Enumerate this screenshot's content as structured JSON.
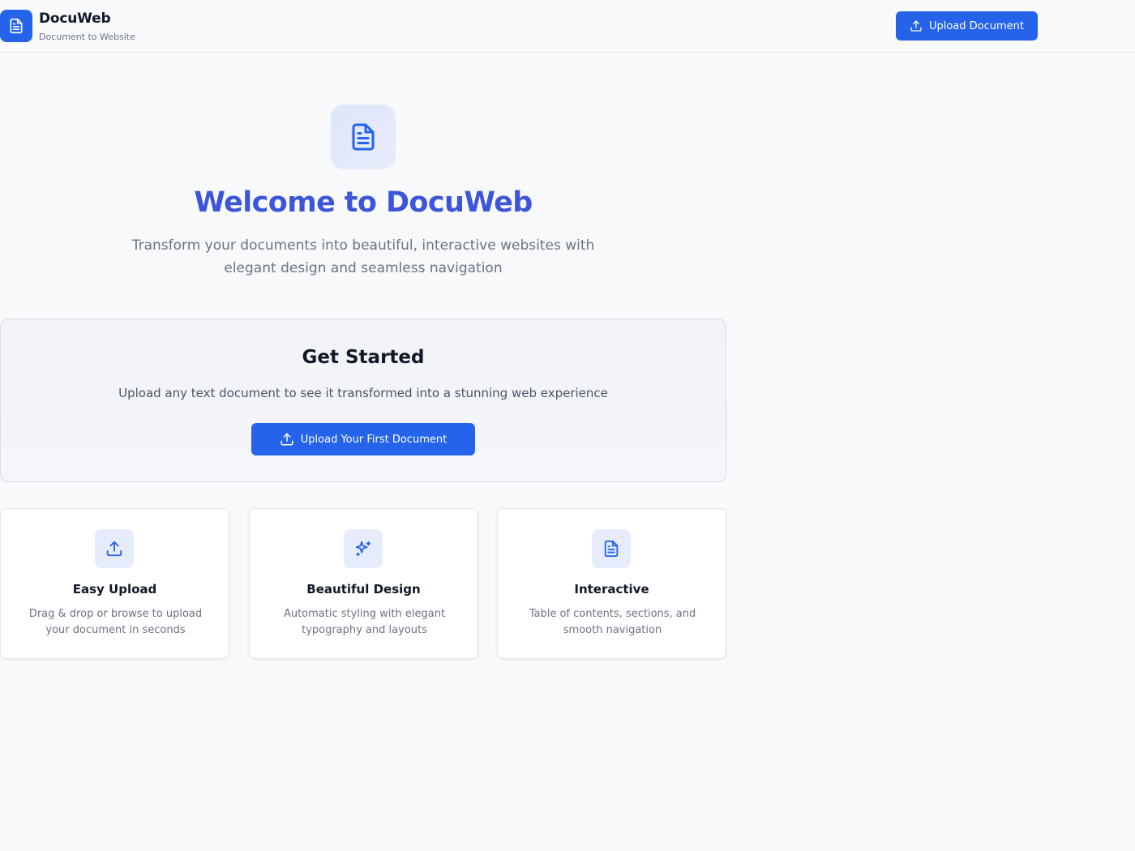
{
  "app": {
    "title": "DocuWeb",
    "subtitle": "Document to Website",
    "brand_color": "#2563eb",
    "logo_icon": "file-text-icon"
  },
  "header": {
    "upload_label": "Upload Document",
    "upload_icon": "upload-icon"
  },
  "hero": {
    "icon": "file-text-icon",
    "title": "Welcome to DocuWeb",
    "title_color": "#3d56d9",
    "subtitle": "Transform your documents into beautiful, interactive websites with elegant design and seamless navigation"
  },
  "get_started": {
    "title": "Get Started",
    "text": "Upload any text document to see it transformed into a stunning web experience",
    "button_label": "Upload Your First Document",
    "button_icon": "upload-icon"
  },
  "features": [
    {
      "icon": "upload-icon",
      "title": "Easy Upload",
      "description": "Drag & drop or browse to upload your document in seconds"
    },
    {
      "icon": "sparkles-icon",
      "title": "Beautiful Design",
      "description": "Automatic styling with elegant typography and layouts"
    },
    {
      "icon": "file-text-icon",
      "title": "Interactive",
      "description": "Table of contents, sections, and smooth navigation"
    }
  ]
}
